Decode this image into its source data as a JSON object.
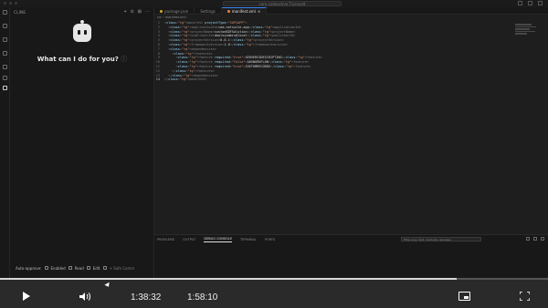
{
  "window": {
    "search_text": "core.codeactive.Ticonex9",
    "accent_color": "#3b82f6"
  },
  "activity_bar": {
    "icons": [
      "explorer-icon",
      "search-icon",
      "source-control-icon",
      "run-debug-icon",
      "extensions-icon",
      "remote-icon",
      "chat-icon"
    ]
  },
  "chat": {
    "title": "CLINE",
    "actions": [
      "+",
      "⊙",
      "⊞",
      "⋯"
    ],
    "welcome": "What can I do for you?",
    "help_glyph": "ⓘ"
  },
  "auto_approve": {
    "label": "Auto-approve:",
    "items": [
      "Enabled",
      "Read",
      "Edit"
    ],
    "more": "+ Safe Comm"
  },
  "editor": {
    "tabs": [
      {
        "label": "package.json",
        "active": false
      },
      {
        "label": "Settings",
        "active": false
      },
      {
        "label": "manifest.xml",
        "active": true
      }
    ],
    "breadcrumb": "src › manifest.xml",
    "lines": [
      {
        "n": "1",
        "code": "<manifest projectType=\"SAPIAPP\">"
      },
      {
        "n": "2",
        "code": "  <applicationId>com.netsuite.app</applicationId>"
      },
      {
        "n": "3",
        "code": "  <projectName>customSDFSolution</projectName>"
      },
      {
        "n": "4",
        "code": "  <publisherId>deployadmin@local</publisherId>"
      },
      {
        "n": "5",
        "code": "  <projectVersion>0.0.1</projectVersion>"
      },
      {
        "n": "6",
        "code": "  <frameworkversion>1.0</frameworkversion>"
      },
      {
        "n": "7",
        "code": "  <dependencies>"
      },
      {
        "n": "8",
        "code": "    <features>"
      },
      {
        "n": "9",
        "code": "      <feature required=\"true\">SERVERSIDESCRIPTING</feature>"
      },
      {
        "n": "10",
        "code": "      <feature required=\"false\">ADVWORKFLOW</feature>"
      },
      {
        "n": "11",
        "code": "      <feature required=\"true\">CUSTOMRECORDS</feature>"
      },
      {
        "n": "12",
        "code": "    </features>"
      },
      {
        "n": "13",
        "code": "  </dependencies>"
      },
      {
        "n": "14",
        "code": "</manifest>"
      }
    ],
    "current_line": "14"
  },
  "panel": {
    "tabs": [
      "PROBLEMS",
      "OUTPUT",
      "DEBUG CONSOLE",
      "TERMINAL",
      "PORTS"
    ],
    "active_tab": "DEBUG CONSOLE",
    "filter_placeholder": "Filter (e.g. text, !exclude, \\escape)"
  },
  "player": {
    "current_time": "1:38:32",
    "duration": "1:58:10",
    "progress_fraction": 0.834
  }
}
